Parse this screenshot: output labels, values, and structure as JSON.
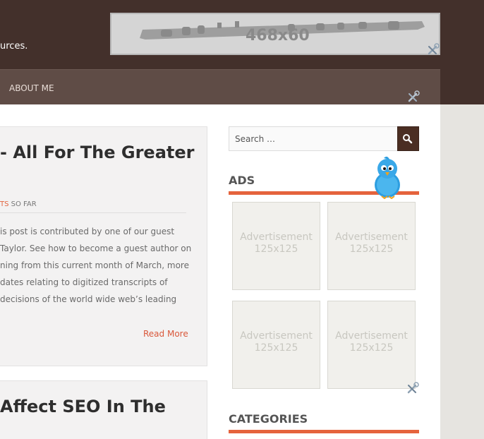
{
  "header": {
    "tagline": "urces.",
    "banner_label": "468x60"
  },
  "nav": {
    "items": [
      {
        "label": "ABOUT ME"
      }
    ]
  },
  "posts": [
    {
      "title": "- All For The Greater",
      "meta_highlight": "TS",
      "meta_rest": " SO FAR",
      "excerpt_lines": [
        "is post is contributed by one of our guest",
        "Taylor. See how to become a guest author on",
        "ning from this current month of March, more",
        "dates relating to digitized transcripts of",
        "decisions of the world wide web’s leading"
      ],
      "read_more": "Read More"
    },
    {
      "title": "Affect SEO In The"
    }
  ],
  "sidebar": {
    "search_placeholder": "Search …",
    "ads_title": "ADS",
    "ads": [
      {
        "line1": "Advertisement",
        "line2": "125x125"
      },
      {
        "line1": "Advertisement",
        "line2": "125x125"
      },
      {
        "line1": "Advertisement",
        "line2": "125x125"
      },
      {
        "line1": "Advertisement",
        "line2": "125x125"
      }
    ],
    "categories_title": "CATEGORIES"
  },
  "icons": {
    "tools": "tools-icon",
    "search": "magnifier-icon",
    "bird": "twitter-bird-icon",
    "flute": "flute-icon"
  },
  "colors": {
    "header_bg": "#43302b",
    "nav_bg": "#5f4c46",
    "accent": "#e5633c",
    "search_button": "#4b2e23"
  }
}
